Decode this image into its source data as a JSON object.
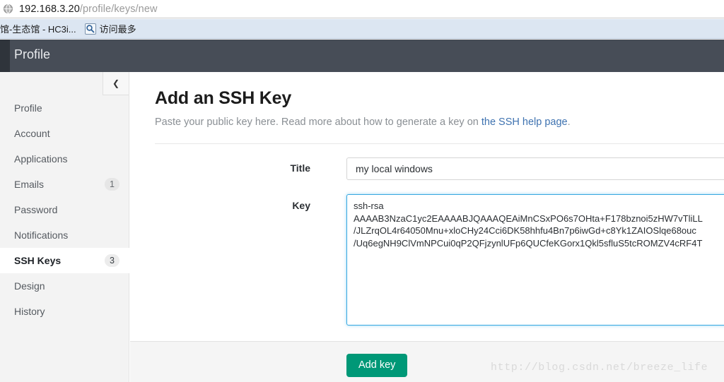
{
  "browser": {
    "url_host": "192.168.3.20",
    "url_path": "/profile/keys/new",
    "bookmarks": [
      {
        "label": "馆-生态馆 - HC3i...",
        "has_favicon": false,
        "icon": "page-icon"
      },
      {
        "label": "访问最多",
        "has_favicon": true,
        "icon": "most-visited-icon"
      }
    ]
  },
  "header": {
    "title": "Profile"
  },
  "sidebar": {
    "collapse_icon": "chevron-left-icon",
    "items": [
      {
        "label": "Profile",
        "badge": "",
        "active": false
      },
      {
        "label": "Account",
        "badge": "",
        "active": false
      },
      {
        "label": "Applications",
        "badge": "",
        "active": false
      },
      {
        "label": "Emails",
        "badge": "1",
        "active": false
      },
      {
        "label": "Password",
        "badge": "",
        "active": false
      },
      {
        "label": "Notifications",
        "badge": "",
        "active": false
      },
      {
        "label": "SSH Keys",
        "badge": "3",
        "active": true
      },
      {
        "label": "Design",
        "badge": "",
        "active": false
      },
      {
        "label": "History",
        "badge": "",
        "active": false
      }
    ]
  },
  "main": {
    "page_title": "Add an SSH Key",
    "subtitle_text": "Paste your public key here. Read more about how to generate a key on ",
    "subtitle_link": "the SSH help page",
    "subtitle_suffix": ".",
    "form": {
      "title_label": "Title",
      "title_value": "my local windows",
      "title_placeholder": "",
      "key_label": "Key",
      "key_value": "ssh-rsa\nAAAAB3NzaC1yc2EAAAABJQAAAQEAiMnCSxPO6s7OHta+F178bznoi5zHW7vTliLL\n/JLZrqOL4r64050Mnu+xloCHy24Cci6DK58hhfu4Bn7p6iwGd+c8Yk1ZAIOSlqe68ouc\n/Uq6egNH9ClVmNPCui0qP2QFjzynlUFp6QUCfeKGorx1Qkl5sfluS5tcROMZV4cRF4T",
      "key_placeholder": "",
      "submit_label": "Add key"
    }
  },
  "watermark": "http://blog.csdn.net/breeze_life",
  "colors": {
    "header_bg": "#474d57",
    "accent_green": "#009877",
    "focus_blue": "#37a7e0",
    "link_blue": "#3e72b0",
    "sidebar_bg": "#f3f3f3"
  }
}
